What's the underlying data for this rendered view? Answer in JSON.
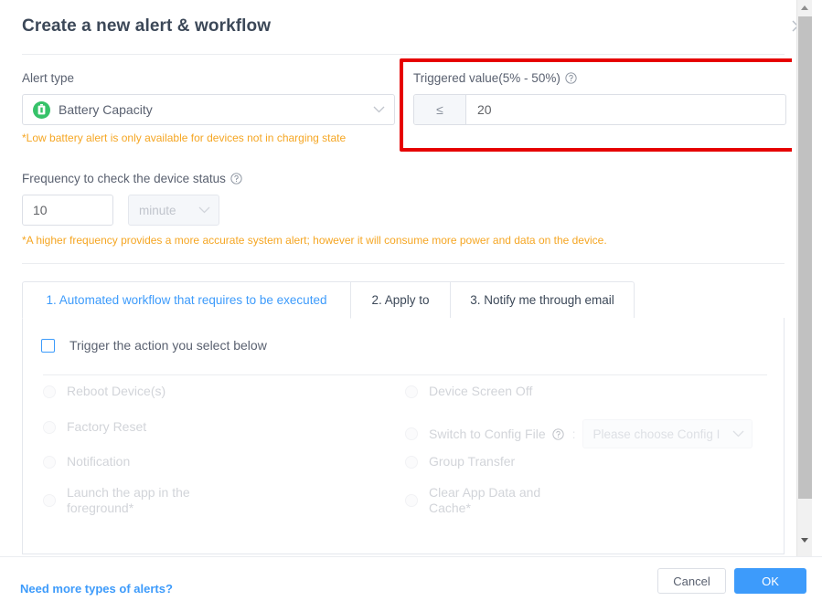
{
  "dialog": {
    "title": "Create a new alert & workflow",
    "close_icon": "close-icon"
  },
  "alert_type": {
    "label": "Alert type",
    "selected": "Battery Capacity",
    "icon": "battery-icon",
    "icon_color": "#36c269",
    "note": "*Low battery alert is only available for devices not in charging state"
  },
  "triggered_value": {
    "label": "Triggered value(5% - 50%)",
    "help_icon": "question-circle-icon",
    "comparator": "≤",
    "value": "20",
    "highlight_color": "#e60000"
  },
  "frequency": {
    "label": "Frequency to check the device status",
    "help_icon": "question-circle-icon",
    "value": "10",
    "unit": "minute",
    "note": "*A higher frequency provides a more accurate system alert; however it will consume more power and data on the device."
  },
  "tabs": [
    {
      "label": "1. Automated workflow that requires to be executed",
      "active": true
    },
    {
      "label": "2. Apply to",
      "active": false
    },
    {
      "label": "3. Notify me through email",
      "active": false
    }
  ],
  "workflow_panel": {
    "trigger_checkbox_label": "Trigger the action you select below",
    "trigger_checked": false,
    "options_left": [
      {
        "label": "Reboot Device(s)"
      },
      {
        "label": "Factory Reset"
      },
      {
        "label": "Notification"
      },
      {
        "label": "Launch the app in the foreground*"
      }
    ],
    "options_right": [
      {
        "label": "Device Screen Off"
      },
      {
        "label": "Switch to Config File"
      },
      {
        "label": "Group Transfer"
      },
      {
        "label": "Clear App Data and Cache*"
      }
    ],
    "config_help_icon": "question-circle-icon",
    "config_separator": ":",
    "config_placeholder": "Please choose Config I"
  },
  "footer": {
    "link": "Need more types of alerts?",
    "cancel_label": "Cancel",
    "ok_label": "OK",
    "ok_color": "#3d9bfb"
  },
  "scrollbar": {
    "up_icon": "caret-up-icon",
    "down_icon": "caret-down-icon"
  }
}
